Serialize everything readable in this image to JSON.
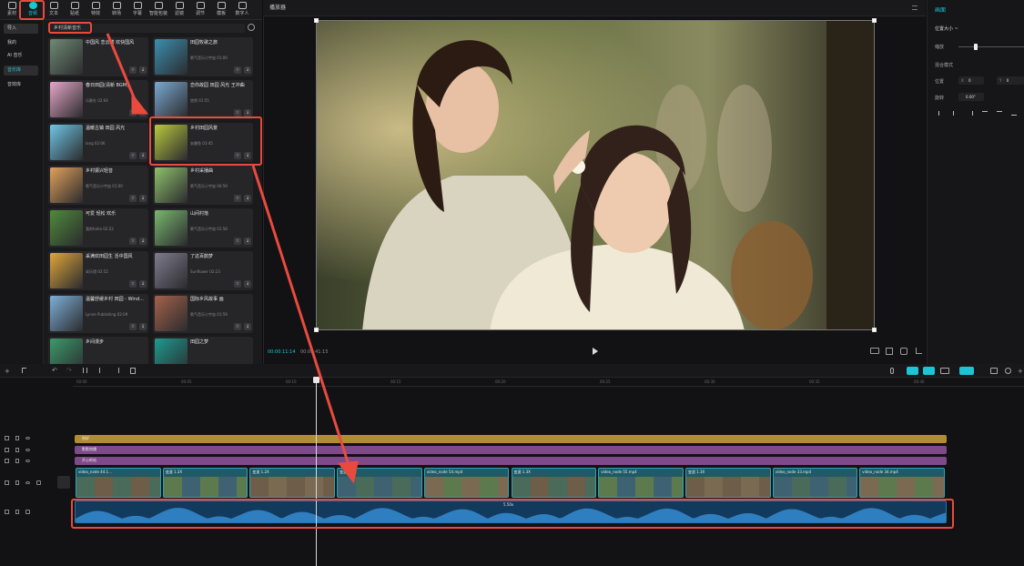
{
  "topbar": {
    "tools": [
      {
        "label": "素材",
        "icon": "media-icon"
      },
      {
        "label": "音频",
        "icon": "audio-icon",
        "active": true
      },
      {
        "label": "文本",
        "icon": "text-icon"
      },
      {
        "label": "贴纸",
        "icon": "sticker-icon"
      },
      {
        "label": "特效",
        "icon": "effects-icon"
      },
      {
        "label": "转场",
        "icon": "transition-icon"
      },
      {
        "label": "字幕",
        "icon": "caption-icon"
      },
      {
        "label": "智能包装",
        "icon": "smart-pack-icon"
      },
      {
        "label": "滤镜",
        "icon": "filter-icon"
      },
      {
        "label": "调节",
        "icon": "adjust-icon"
      },
      {
        "label": "模板",
        "icon": "template-icon"
      },
      {
        "label": "数字人",
        "icon": "avatar-icon"
      }
    ],
    "accent": "#1bc5d6"
  },
  "sidebar": {
    "items": [
      {
        "label": "导入",
        "selected": true
      },
      {
        "label": "我的"
      },
      {
        "label": "AI 音乐"
      },
      {
        "label": "音乐库",
        "active": true
      },
      {
        "label": "音效库"
      }
    ]
  },
  "search": {
    "value": "乡村清新音乐"
  },
  "library": {
    "cards": [
      {
        "title": "中国风 恋云楼 欢快国风",
        "sub": "",
        "color": "#6f8a74"
      },
      {
        "title": "田园牧歌之旅",
        "sub": "氧气音乐小宇宙 01:00",
        "color": "#3b8fb0"
      },
      {
        "title": "春日田园(清新 BGM)",
        "sub": "乐歌社 02:04",
        "color": "#e6a7c9"
      },
      {
        "title": "恋你故园 田园 风光 王冲曲",
        "sub": "悠然 01:55",
        "color": "#7aa9d1"
      },
      {
        "title": "温暖古镇 田园 风光",
        "sub": "lang 02:06",
        "color": "#6ec7e6"
      },
      {
        "title": "乡村田园风景",
        "sub": "安静鱼 03:45",
        "color": "#b9c93d"
      },
      {
        "title": "乡村振兴轻音",
        "sub": "氧气音乐小宇宙 01:00",
        "color": "#e1a15a"
      },
      {
        "title": "乡村采播曲",
        "sub": "氧气音乐小宇宙 00:59",
        "color": "#8fc16b"
      },
      {
        "title": "可爱 轻松 欢乐",
        "sub": "我的haha 02:22",
        "color": "#4f8b3a"
      },
      {
        "title": "山间村落",
        "sub": "氧气音乐小宇宙 01:58",
        "color": "#79b86f"
      },
      {
        "title": "采满欢田园生 活中国风",
        "sub": "采乐馆 02:52",
        "color": "#e0a63a"
      },
      {
        "title": "了这百鹊梦",
        "sub": "Sunflower 02:23",
        "color": "#7e7c8d"
      },
      {
        "title": "温馨舒缓乡村 田园 - Wind...",
        "sub": "Lynne Publishing 02:09",
        "color": "#7db0d9"
      },
      {
        "title": "国际乡风故事 画",
        "sub": "氧气音乐小宇宙 01:59",
        "color": "#a5624b"
      },
      {
        "title": "乡间漫步",
        "sub": "",
        "color": "#3b9a6a"
      },
      {
        "title": "田园之梦",
        "sub": "",
        "color": "#1d9b8f"
      }
    ]
  },
  "player": {
    "title": "播放器",
    "time_current": "00:00:11:14",
    "time_total": "00:00:41:15"
  },
  "props": {
    "title": "画面",
    "section1": "位置大小 ~",
    "scale_label": "缩放",
    "section2": "混合模式",
    "pos_label": "位置",
    "pos_x": "0",
    "pos_y": "0",
    "rot_label": "旋转",
    "rot_val": "0.00°"
  },
  "timeline": {
    "ticks": [
      "00:00",
      "00:05",
      "00:10",
      "00:15",
      "00:20",
      "00:25",
      "00:30",
      "00:35",
      "00:40"
    ],
    "text_track_label": "你好",
    "purple1_label": "默默热播",
    "purple2_label": "开心的站",
    "clip_labels": [
      "video_node 44.1...",
      "变速 1.3X",
      "变速 1.2X",
      "变速 1.3X",
      "video_node 54.mp4",
      "变速 1.3X",
      "video_node 55.mp4",
      "变速 1.3X",
      "video_node 33.mp4",
      "video_node 34.mp4"
    ],
    "audio_label": "5.50x"
  }
}
